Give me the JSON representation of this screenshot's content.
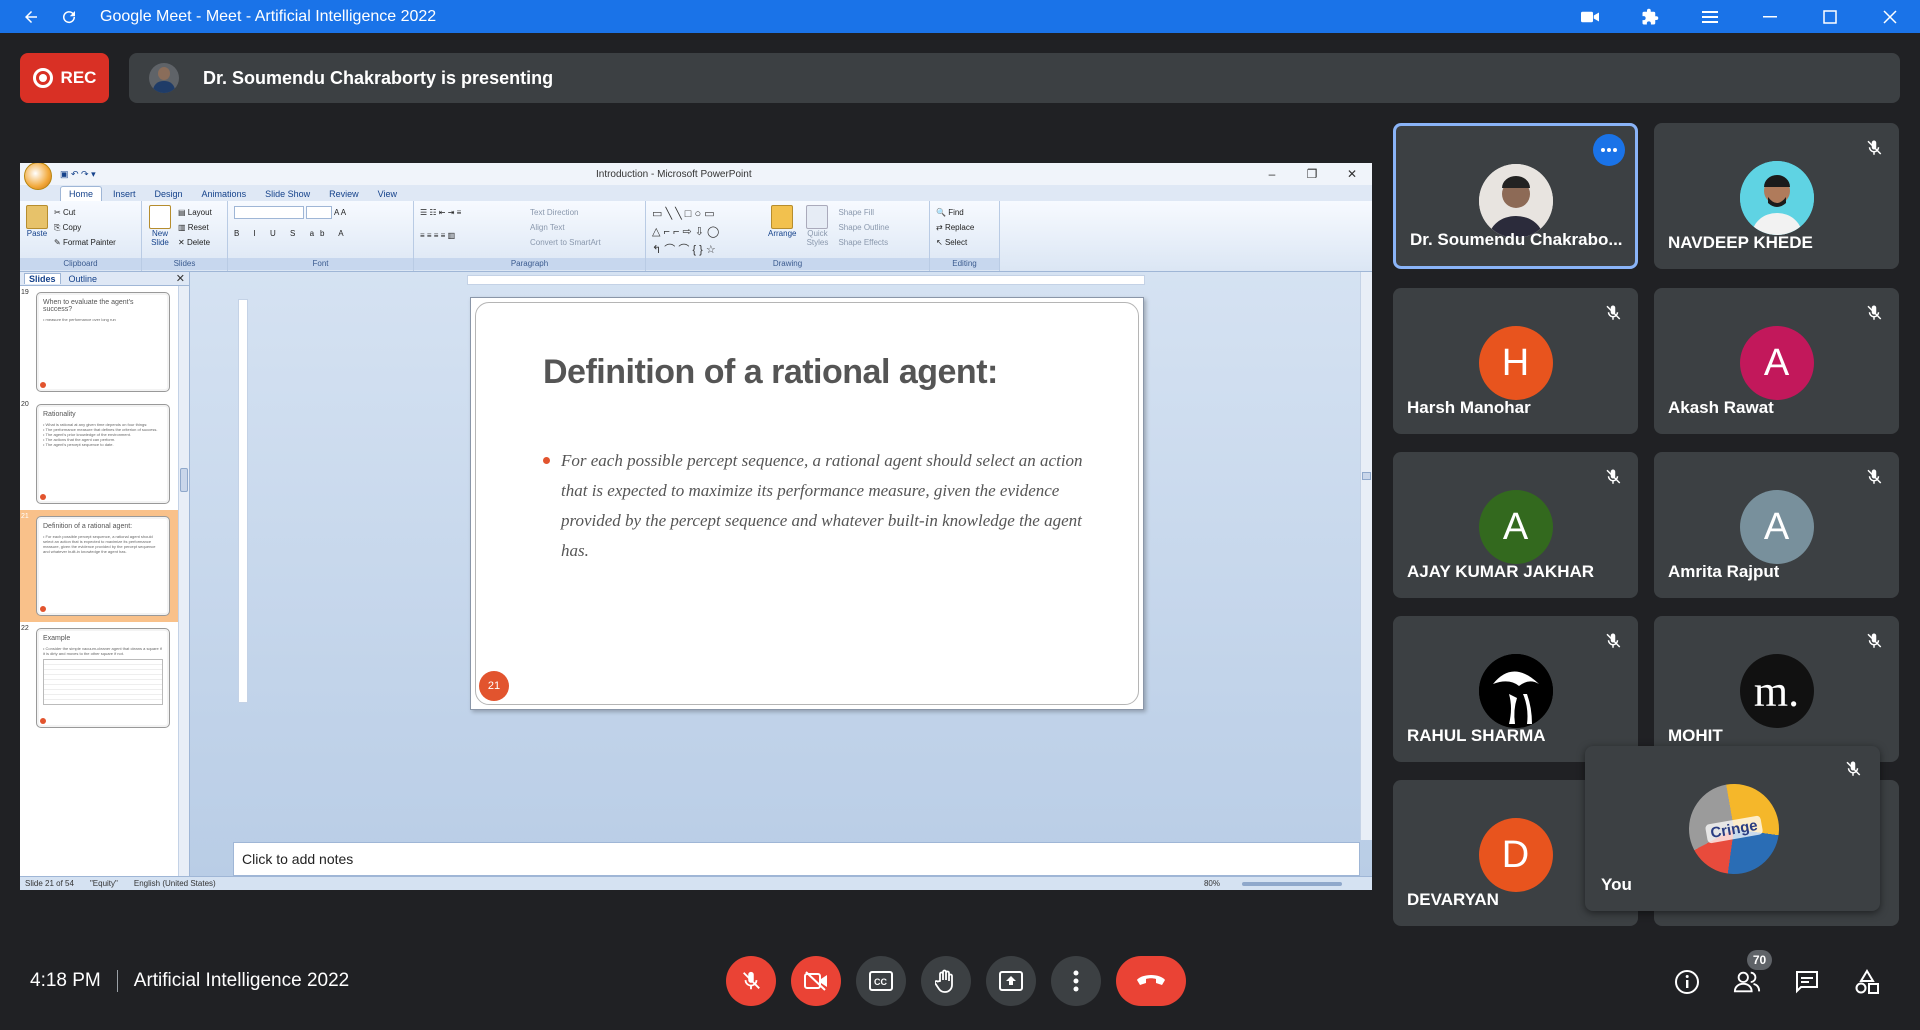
{
  "browser": {
    "title": "Google Meet - Meet - Artificial Intelligence 2022"
  },
  "recording": {
    "label": "REC"
  },
  "presenting_banner": {
    "text": "Dr. Soumendu Chakraborty is presenting"
  },
  "powerpoint": {
    "window_title": "Introduction - Microsoft PowerPoint",
    "tabs": [
      "Home",
      "Insert",
      "Design",
      "Animations",
      "Slide Show",
      "Review",
      "View"
    ],
    "ribbon": {
      "clipboard": {
        "paste": "Paste",
        "cut": "Cut",
        "copy": "Copy",
        "format_painter": "Format Painter",
        "group": "Clipboard"
      },
      "slides": {
        "new_slide": "New Slide",
        "layout": "Layout",
        "reset": "Reset",
        "delete": "Delete",
        "group": "Slides"
      },
      "font": {
        "group": "Font"
      },
      "paragraph": {
        "text_direction": "Text Direction",
        "align_text": "Align Text",
        "convert_smartart": "Convert to SmartArt",
        "group": "Paragraph"
      },
      "drawing": {
        "arrange": "Arrange",
        "quick_styles": "Quick Styles",
        "shape_fill": "Shape Fill",
        "shape_outline": "Shape Outline",
        "shape_effects": "Shape Effects",
        "group": "Drawing"
      },
      "editing": {
        "find": "Find",
        "replace": "Replace",
        "select": "Select",
        "group": "Editing"
      }
    },
    "pane_tabs": {
      "slides": "Slides",
      "outline": "Outline"
    },
    "thumbnails": [
      {
        "num": "19",
        "title": "When to evaluate the agent's success?",
        "lines": [
          "• measure the performance over long run"
        ]
      },
      {
        "num": "20",
        "title": "Rationality",
        "lines": [
          "• What is rational at any given time depends on four things:",
          "• The performance measure that defines the criterion of success.",
          "• The agent's prior knowledge of the environment.",
          "• The actions that the agent can perform.",
          "• The agent's percept sequence to date."
        ]
      },
      {
        "num": "21",
        "title": "Definition of a rational agent:",
        "lines": [
          "• For each possible percept sequence, a rational agent should select an action that is expected to maximize its performance measure, given the evidence provided by the percept sequence and whatever built-in knowledge the agent has."
        ]
      },
      {
        "num": "22",
        "title": "Example",
        "lines": [
          "• Consider the simple vacuum-cleaner agent that cleans a square if it is dirty and moves to the other square if not."
        ]
      }
    ],
    "slide": {
      "title": "Definition of a rational agent:",
      "bullet": "For each possible percept sequence, a rational agent should select an action that is expected to maximize its performance measure, given the evidence provided by the percept sequence and whatever built-in knowledge the agent has.",
      "number": "21"
    },
    "notes_placeholder": "Click to add notes",
    "status": {
      "slide_of": "Slide 21 of 54",
      "theme": "\"Equity\"",
      "language": "English (United States)",
      "zoom": "80%"
    }
  },
  "participants": [
    {
      "name": "Dr. Soumendu Chakrabo...",
      "avatar_type": "photo",
      "active": true
    },
    {
      "name": "NAVDEEP KHEDE",
      "avatar_type": "photo"
    },
    {
      "name": "Harsh Manohar",
      "initial": "H",
      "color": "#e8541e"
    },
    {
      "name": "Akash Rawat",
      "initial": "A",
      "color": "#c2185b"
    },
    {
      "name": "AJAY KUMAR JAKHAR",
      "initial": "A",
      "color": "#33691e"
    },
    {
      "name": "Amrita Rajput",
      "initial": "A",
      "color": "#78909c"
    },
    {
      "name": "RAHUL SHARMA",
      "avatar_type": "photo"
    },
    {
      "name": "MOHIT",
      "initial": "m.",
      "color": "#111111"
    },
    {
      "name": "DEVARYAN",
      "initial": "D",
      "color": "#e8541e"
    }
  ],
  "self_view": {
    "name": "You",
    "avatar_text": "Cringe"
  },
  "bottom_bar": {
    "time": "4:18 PM",
    "meeting_name": "Artificial Intelligence 2022",
    "participant_count": "70"
  }
}
